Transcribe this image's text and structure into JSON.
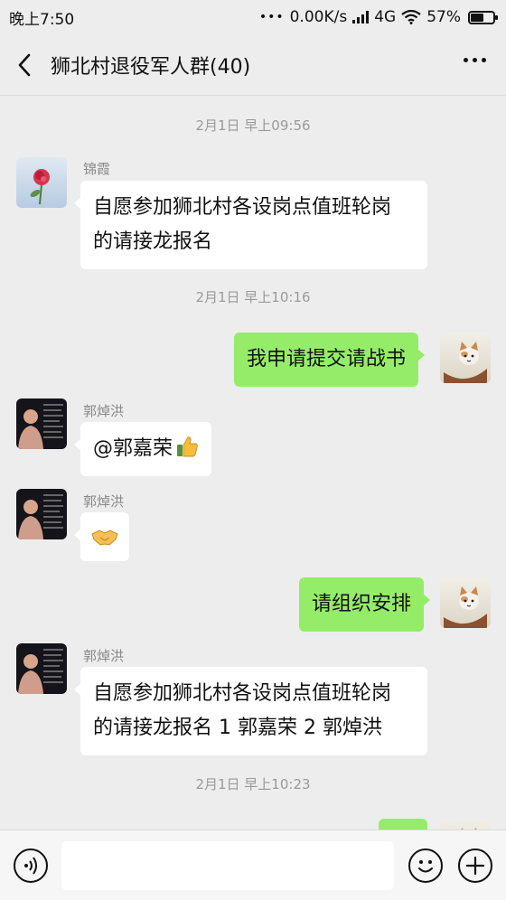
{
  "status_bar": {
    "time": "晚上7:50",
    "dots": "•••",
    "network_speed": "0.00K/s",
    "network_type": "4G",
    "battery_percent": "57%",
    "battery_level": 0.57
  },
  "header": {
    "title": "狮北村退役军人群(40)"
  },
  "messages": [
    {
      "type": "time",
      "text": "2月1日 早上09:56"
    },
    {
      "type": "incoming",
      "sender": "锦霞",
      "avatar": "rose-avatar",
      "lines": [
        "自愿参加狮北村各设岗点值班轮岗",
        "的请接龙报名"
      ]
    },
    {
      "type": "time",
      "text": "2月1日 早上10:16"
    },
    {
      "type": "outgoing",
      "avatar": "cat-avatar",
      "text": "我申请提交请战书"
    },
    {
      "type": "incoming",
      "sender": "郭焯洪",
      "avatar": "man-avatar",
      "text": "@郭嘉荣",
      "emoji": "thumbs-up"
    },
    {
      "type": "incoming",
      "sender": "郭焯洪",
      "avatar": "man-avatar",
      "emoji": "handshake"
    },
    {
      "type": "outgoing",
      "avatar": "cat-avatar",
      "text": "请组织安排"
    },
    {
      "type": "incoming",
      "sender": "郭焯洪",
      "avatar": "man-avatar",
      "lines": [
        "自愿参加狮北村各设岗点值班轮岗",
        "的请接龙报名 1 郭嘉荣 2 郭焯洪"
      ]
    },
    {
      "type": "time",
      "text": "2月1日 早上10:23"
    }
  ],
  "input_bar": {
    "placeholder": ""
  }
}
